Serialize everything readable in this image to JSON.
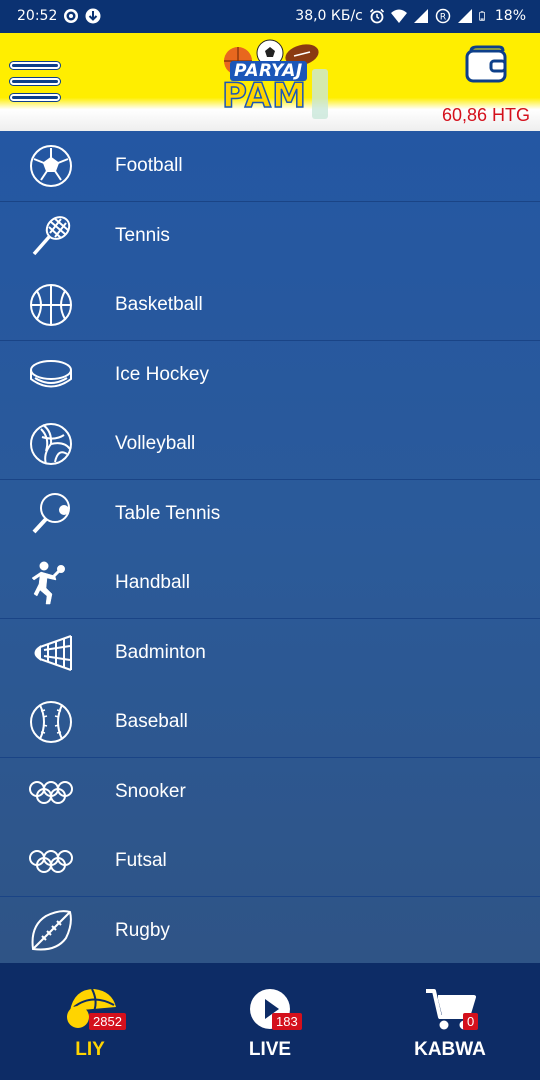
{
  "status_bar": {
    "time": "20:52",
    "network_speed": "38,0 КБ/с",
    "battery": "18%"
  },
  "header": {
    "logo_line1": "PARYAJ",
    "logo_line2": "PAM",
    "balance": "60,86 HTG"
  },
  "sports": [
    {
      "label": "Football",
      "icon": "football-icon"
    },
    {
      "label": "Tennis",
      "icon": "tennis-icon"
    },
    {
      "label": "Basketball",
      "icon": "basketball-icon"
    },
    {
      "label": "Ice Hockey",
      "icon": "ice-hockey-icon"
    },
    {
      "label": "Volleyball",
      "icon": "volleyball-icon"
    },
    {
      "label": "Table Tennis",
      "icon": "table-tennis-icon"
    },
    {
      "label": "Handball",
      "icon": "handball-icon"
    },
    {
      "label": "Badminton",
      "icon": "badminton-icon"
    },
    {
      "label": "Baseball",
      "icon": "baseball-icon"
    },
    {
      "label": "Snooker",
      "icon": "olympic-rings-icon"
    },
    {
      "label": "Futsal",
      "icon": "olympic-rings-icon"
    },
    {
      "label": "Rugby",
      "icon": "rugby-icon"
    }
  ],
  "bottom_nav": {
    "liy": {
      "label": "LIY",
      "badge": "2852"
    },
    "live": {
      "label": "LIVE",
      "badge": "183"
    },
    "kabwa": {
      "label": "KABWA",
      "badge": "0"
    }
  },
  "colors": {
    "header_yellow": "#ffee00",
    "list_blue": "#2457a3",
    "nav_dark": "#0d2c66",
    "accent_yellow": "#ffd400",
    "badge_red": "#d4101c",
    "balance_red": "#d4101c"
  }
}
